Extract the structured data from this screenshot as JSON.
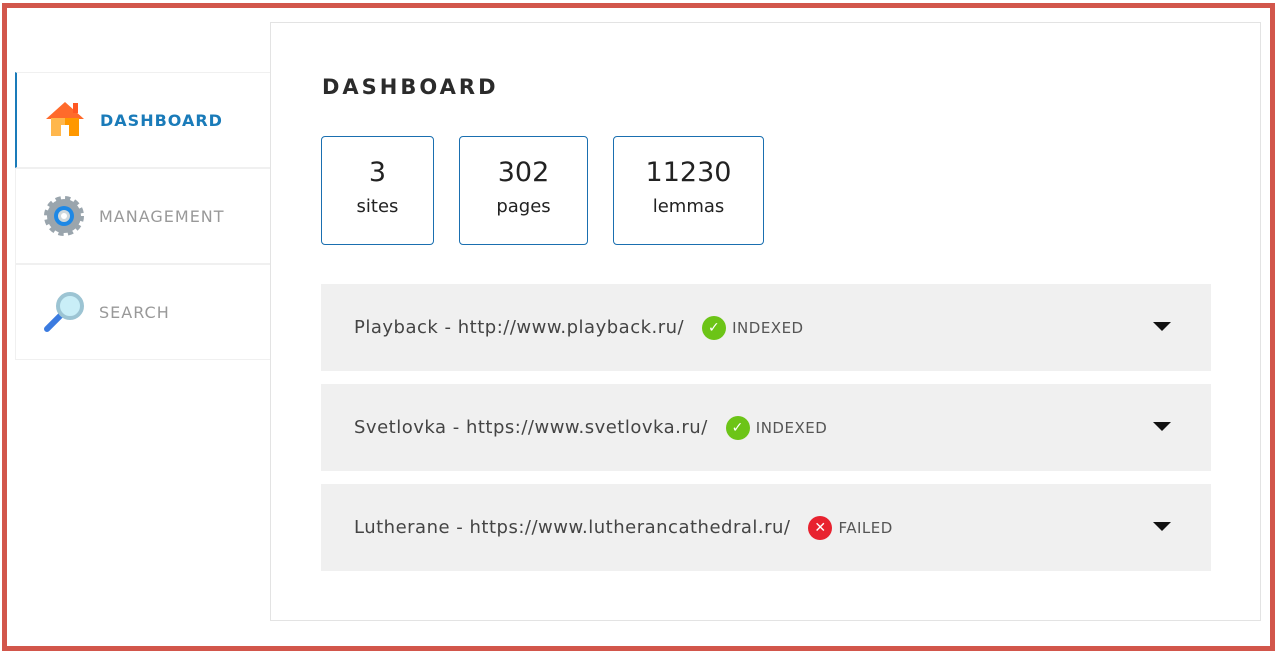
{
  "sidebar": {
    "items": [
      {
        "label": "DASHBOARD",
        "icon": "home-icon",
        "active": true
      },
      {
        "label": "MANAGEMENT",
        "icon": "gear-icon"
      },
      {
        "label": "SEARCH",
        "icon": "magnifier-icon"
      }
    ]
  },
  "main": {
    "title": "DASHBOARD",
    "stats": [
      {
        "value": "3",
        "label": "sites"
      },
      {
        "value": "302",
        "label": "pages"
      },
      {
        "value": "11230",
        "label": "lemmas"
      }
    ],
    "sites": [
      {
        "name": "Playback - http://www.playback.ru/",
        "status": "INDEXED",
        "status_color": "#6cc417"
      },
      {
        "name": "Svetlovka - https://www.svetlovka.ru/",
        "status": "INDEXED",
        "status_color": "#6cc417"
      },
      {
        "name": "Lutherane - https://www.lutherancathedral.ru/",
        "status": "FAILED",
        "status_color": "#e8222f"
      }
    ]
  }
}
